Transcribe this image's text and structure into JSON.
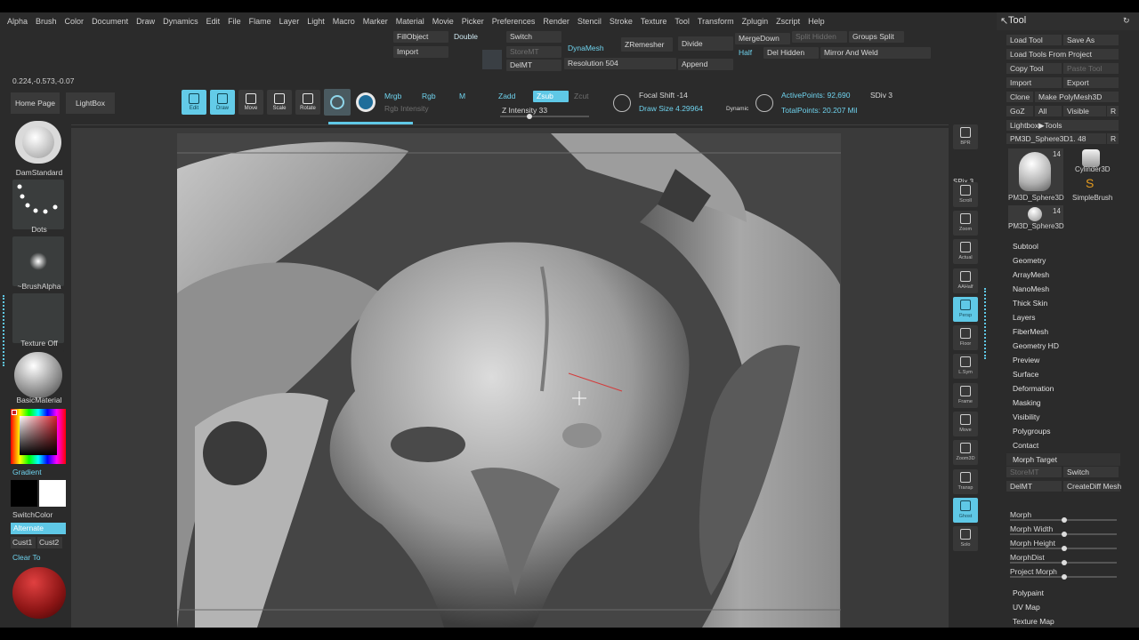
{
  "menu": [
    "Alpha",
    "Brush",
    "Color",
    "Document",
    "Draw",
    "Dynamics",
    "Edit",
    "File",
    "Flame",
    "Layer",
    "Light",
    "Macro",
    "Marker",
    "Material",
    "Movie",
    "Picker",
    "Preferences",
    "Render",
    "Stencil",
    "Stroke",
    "Texture",
    "Tool",
    "Transform",
    "Zplugin",
    "Zscript",
    "Help"
  ],
  "coords": "0.224,-0.573,-0.07",
  "shelf": {
    "fillobject": "FillObject",
    "double": "Double",
    "import": "Import",
    "switch": "Switch",
    "storemt": "StoreMT",
    "delmt": "DelMT",
    "dynamesh": "DynaMesh",
    "resolution_label": "Resolution",
    "resolution_value": "504",
    "zremesher": "ZRemesher",
    "divide": "Divide",
    "append": "Append",
    "mergedown": "MergeDown",
    "split_hidden": "Split Hidden",
    "groups_split": "Groups Split",
    "half": "Half",
    "del_hidden": "Del Hidden",
    "mirror_and_weld": "Mirror And Weld"
  },
  "nav": {
    "home": "Home Page",
    "lightbox": "LightBox"
  },
  "tools": [
    {
      "name": "edit",
      "label": "Edit",
      "icon": "edit-icon",
      "on": true
    },
    {
      "name": "draw",
      "label": "Draw",
      "icon": "draw-icon",
      "on": true
    },
    {
      "name": "move",
      "label": "Move",
      "icon": "move-icon",
      "on": false
    },
    {
      "name": "scale",
      "label": "Scale",
      "icon": "scale-icon",
      "on": false
    },
    {
      "name": "rotate",
      "label": "Rotate",
      "icon": "rotate-icon",
      "on": false
    }
  ],
  "draw_settings": {
    "mrgb": "Mrgb",
    "rgb": "Rgb",
    "m": "M",
    "rgb_intensity": "Rgb Intensity",
    "zadd": "Zadd",
    "zsub": "Zsub",
    "zcut": "Zcut",
    "z_intensity_label": "Z Intensity",
    "z_intensity_value": "33",
    "z_intensity_fraction": 0.33,
    "focal_shift_label": "Focal Shift",
    "focal_shift_value": "-14",
    "draw_size_label": "Draw Size",
    "draw_size_value": "4.29964",
    "dynamic": "Dynamic",
    "active_points": "ActivePoints: 92,690",
    "total_points": "TotalPoints: 20.207 Mil",
    "sdiv": "SDiv 3"
  },
  "left": {
    "brush": "DamStandard",
    "stroke": "Dots",
    "alpha": "~BrushAlpha",
    "texture": "Texture Off",
    "material": "BasicMaterial",
    "gradient": "Gradient",
    "switch_color": "SwitchColor",
    "alternate": "Alternate",
    "cust1": "Cust1",
    "cust2": "Cust2",
    "clear_to": "Clear To"
  },
  "right_strip": [
    {
      "name": "bpr",
      "label": "BPR",
      "icon": "bpr-icon",
      "on": false
    },
    {
      "name": "spix",
      "label": "SPix 3",
      "icon": "",
      "on": false
    },
    {
      "name": "scroll",
      "label": "Scroll",
      "icon": "scroll-icon",
      "on": false
    },
    {
      "name": "zoom",
      "label": "Zoom",
      "icon": "zoom-icon",
      "on": false
    },
    {
      "name": "actual",
      "label": "Actual",
      "icon": "actual-icon",
      "on": false
    },
    {
      "name": "aahalf",
      "label": "AAHalf",
      "icon": "aahalf-icon",
      "on": false
    },
    {
      "name": "persp",
      "label": "Persp",
      "icon": "persp-icon",
      "on": true
    },
    {
      "name": "floor",
      "label": "Floor",
      "icon": "floor-icon",
      "on": false
    },
    {
      "name": "lsym",
      "label": "L.Sym",
      "icon": "lsym-icon",
      "on": false
    },
    {
      "name": "frame",
      "label": "Frame",
      "icon": "frame-icon",
      "on": false
    },
    {
      "name": "move",
      "label": "Move",
      "icon": "move-icon",
      "on": false
    },
    {
      "name": "zoom3d",
      "label": "Zoom3D",
      "icon": "zoom3d-icon",
      "on": false
    },
    {
      "name": "transp",
      "label": "Transp",
      "icon": "transp-icon",
      "on": false
    },
    {
      "name": "ghost",
      "label": "Ghost",
      "icon": "ghost-icon",
      "on": true
    },
    {
      "name": "solo",
      "label": "Solo",
      "icon": "solo-icon",
      "on": false
    }
  ],
  "tool_panel": {
    "title": "Tool",
    "load_tool": "Load Tool",
    "save_as": "Save As",
    "load_tools_from_project": "Load Tools From Project",
    "copy_tool": "Copy Tool",
    "paste_tool": "Paste Tool",
    "import": "Import",
    "export": "Export",
    "clone": "Clone",
    "make_polymesh": "Make PolyMesh3D",
    "goz": "GoZ",
    "all": "All",
    "visible": "Visible",
    "r": "R",
    "lightbox_tools": "Lightbox▶Tools",
    "current_tool": "PM3D_Sphere3D1. 48",
    "thumbs": [
      {
        "label": "PM3D_Sphere3D",
        "count": "14"
      },
      {
        "label": "Cylinder3D",
        "count": ""
      },
      {
        "label": "SimpleBrush",
        "count": ""
      },
      {
        "label": "PM3D_Sphere3D",
        "count": "14"
      }
    ],
    "sections": [
      "Subtool",
      "Geometry",
      "ArrayMesh",
      "NanoMesh",
      "Thick Skin",
      "Layers",
      "FiberMesh",
      "Geometry HD",
      "Preview",
      "Surface",
      "Deformation",
      "Masking",
      "Visibility",
      "Polygroups",
      "Contact"
    ],
    "morph_target": "Morph Target",
    "storemt": "StoreMT",
    "switch": "Switch",
    "delmt": "DelMT",
    "create_diff_mesh": "CreateDiff Mesh",
    "morph": "Morph",
    "morph_width": "Morph Width",
    "morph_height": "Morph Height",
    "morph_dist": "MorphDist",
    "project_morph": "Project Morph",
    "bottom_sections": [
      "Polypaint",
      "UV Map",
      "Texture Map"
    ]
  }
}
